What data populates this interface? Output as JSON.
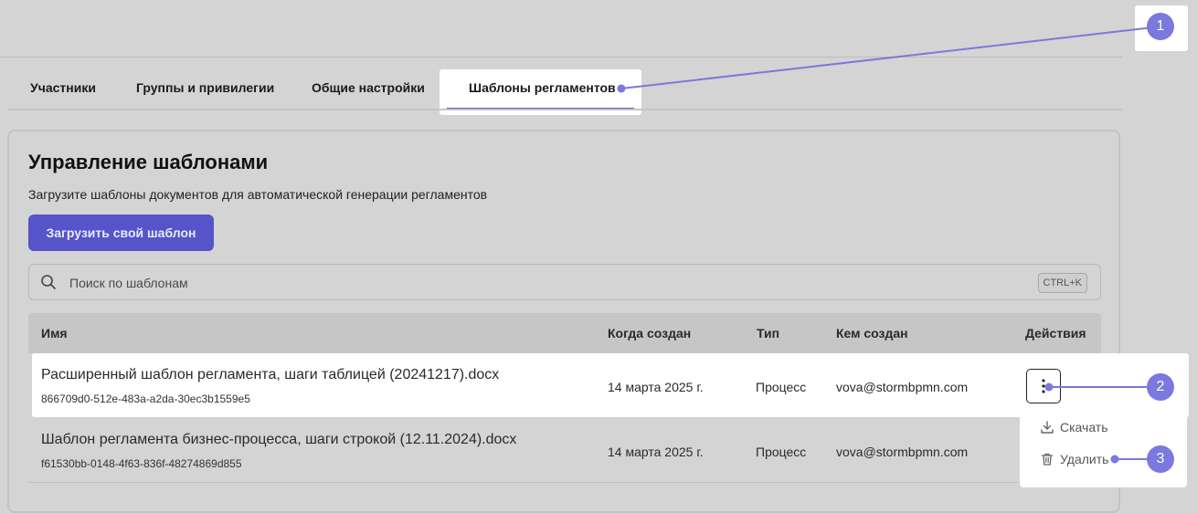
{
  "tabs": [
    {
      "label": "Участники"
    },
    {
      "label": "Группы и привилегии"
    },
    {
      "label": "Общие настройки"
    },
    {
      "label": "Шаблоны регламентов"
    }
  ],
  "header": {
    "title": "Управление шаблонами",
    "subtitle": "Загрузите шаблоны документов для автоматической генерации регламентов",
    "upload_label": "Загрузить свой шаблон"
  },
  "search": {
    "placeholder": "Поиск по шаблонам",
    "shortcut": "CTRL+K"
  },
  "table": {
    "columns": [
      "Имя",
      "Когда создан",
      "Тип",
      "Кем создан",
      "Действия"
    ],
    "rows": [
      {
        "name": "Расширенный шаблон регламента, шаги таблицей (20241217).docx",
        "id": "866709d0-512e-483a-a2da-30ec3b1559e5",
        "created": "14 марта 2025 г.",
        "type": "Процесс",
        "author": "vova@stormbpmn.com"
      },
      {
        "name": "Шаблон регламента бизнес-процесса, шаги строкой (12.11.2024).docx",
        "id": "f61530bb-0148-4f63-836f-48274869d855",
        "created": "14 марта 2025 г.",
        "type": "Процесс",
        "author": "vova@stormbpmn.com"
      }
    ]
  },
  "menu": {
    "download_label": "Скачать",
    "delete_label": "Удалить"
  },
  "annotations": [
    "1",
    "2",
    "3"
  ],
  "colors": {
    "accent": "#5753c9",
    "annotation": "#7b78de",
    "background": "#d4d4d4"
  }
}
